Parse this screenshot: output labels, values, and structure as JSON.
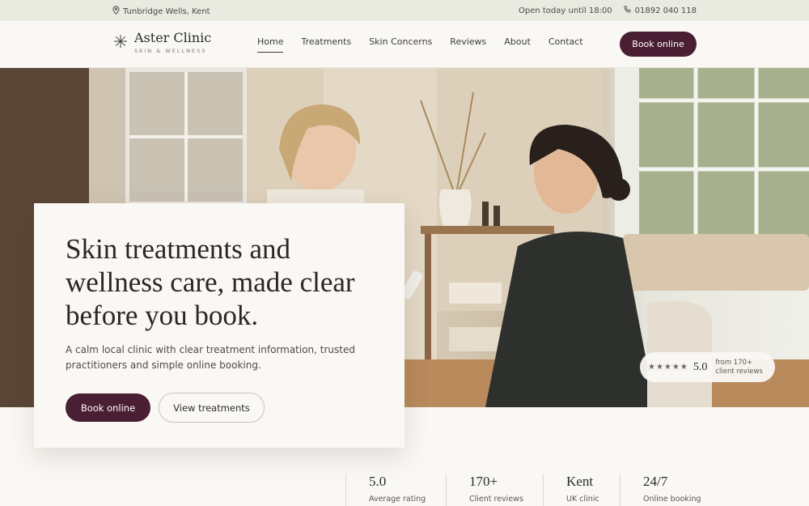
{
  "topbar": {
    "location": "Tunbridge Wells, Kent",
    "hours": "Open today until 18:00",
    "phone": "01892 040 118"
  },
  "brand": {
    "name": "Aster Clinic",
    "tagline": "SKIN & WELLNESS"
  },
  "nav": {
    "home": "Home",
    "treatments": "Treatments",
    "concerns": "Skin Concerns",
    "reviews": "Reviews",
    "about": "About",
    "contact": "Contact"
  },
  "header_cta": "Book online",
  "hero": {
    "heading": "Skin treatments and wellness care, made clear before you book.",
    "body": "A calm local clinic with clear treatment information, trusted practitioners and simple online booking.",
    "primary_cta": "Book online",
    "secondary_cta": "View treatments"
  },
  "rating_badge": {
    "stars": "★★★★★",
    "score": "5.0",
    "from": "from 170+ client reviews"
  },
  "stats": [
    {
      "value": "5.0",
      "label": "Average rating"
    },
    {
      "value": "170+",
      "label": "Client reviews"
    },
    {
      "value": "Kent",
      "label": "UK clinic"
    },
    {
      "value": "24/7",
      "label": "Online booking"
    }
  ],
  "colors": {
    "accent": "#4a1f33",
    "topbar": "#e9ebe1",
    "background": "#faf8f4"
  }
}
